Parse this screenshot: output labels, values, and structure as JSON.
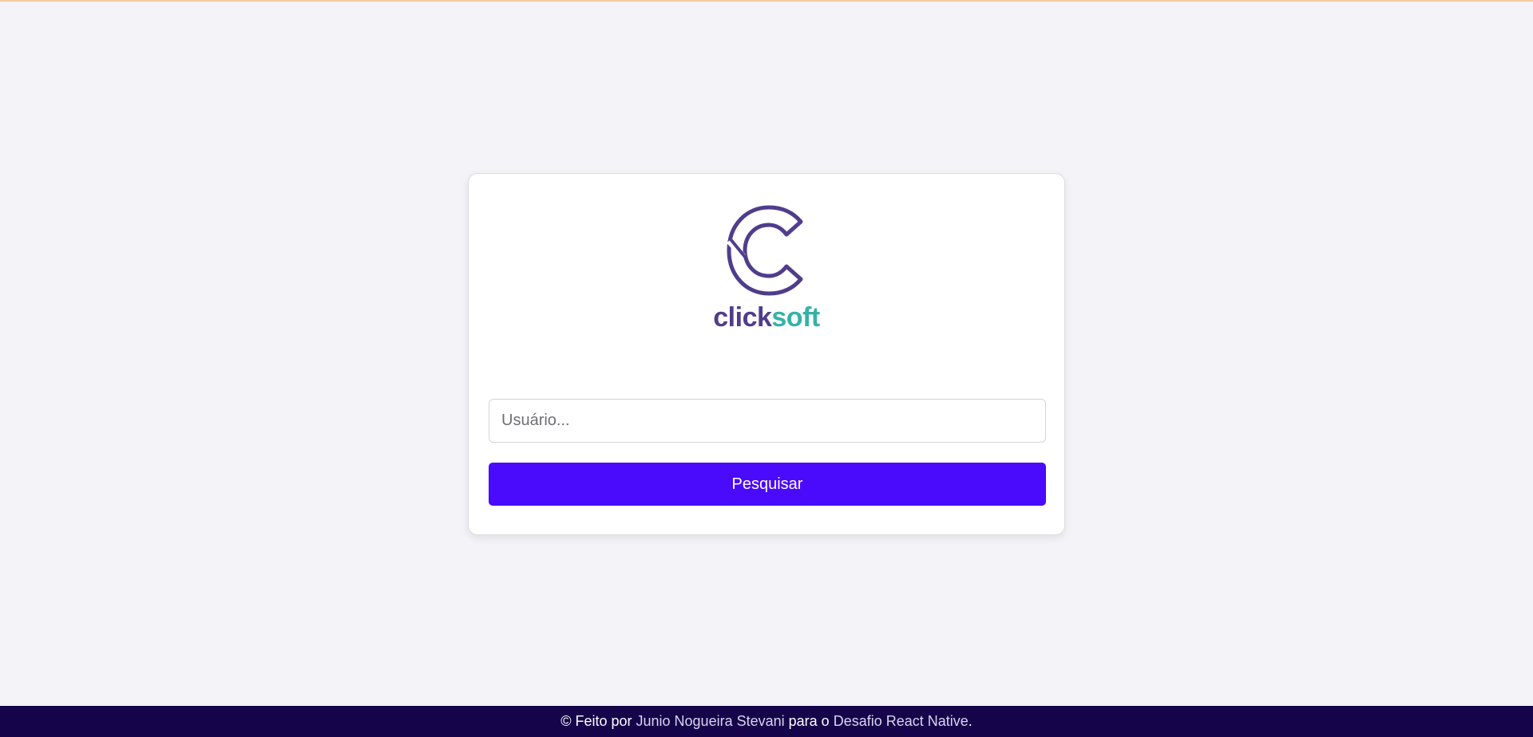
{
  "brand": {
    "name_part_a": "click",
    "name_part_b": "soft",
    "icon": "clicksoft-c-logo-icon",
    "colors": {
      "purple": "#4f3d8c",
      "teal": "#35b2a8"
    }
  },
  "search": {
    "placeholder": "Usuário...",
    "value": "",
    "button_label": "Pesquisar",
    "button_color": "#4a0afc"
  },
  "footer": {
    "prefix": "© Feito por",
    "author": "Junio Nogueira Stevani",
    "middle": "para o",
    "project": "Desafio React Native",
    "suffix": ".",
    "background_color": "#15044a"
  }
}
